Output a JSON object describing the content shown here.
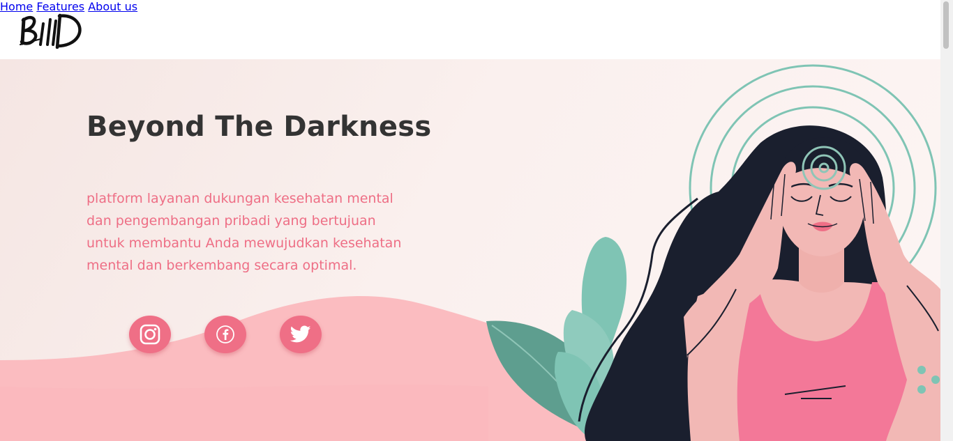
{
  "header": {
    "logo_text": "BIID",
    "nav": [
      {
        "label": "Home"
      },
      {
        "label": "Features"
      },
      {
        "label": "About us"
      }
    ]
  },
  "hero": {
    "title": "Beyond The Darkness",
    "description": "platform layanan dukungan kesehatan mental dan pengembangan pribadi yang bertujuan untuk membantu Anda mewujudkan kesehatan mental dan berkembang secara optimal.",
    "social": [
      {
        "icon": "instagram-icon"
      },
      {
        "icon": "facebook-icon"
      },
      {
        "icon": "twitter-icon"
      }
    ]
  },
  "colors": {
    "accent_pink": "#ef6f86",
    "text_pink": "#ee6e85",
    "title": "#333333",
    "wave_pink": "#fbbcc0",
    "teal": "#7fc4b4",
    "hair": "#1a1f2e"
  }
}
